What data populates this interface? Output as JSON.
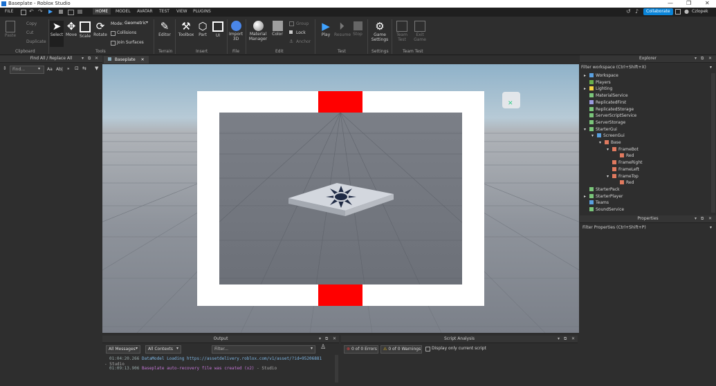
{
  "window": {
    "title": "Baseplate - Roblox Studio",
    "user": "Czlopek",
    "collaborate_label": "Collaborate"
  },
  "menu": {
    "file": "FILE",
    "tabs": [
      "HOME",
      "MODEL",
      "AVATAR",
      "TEST",
      "VIEW",
      "PLUGINS"
    ],
    "active_tab": "HOME"
  },
  "ribbon": {
    "clipboard": {
      "paste": "Paste",
      "copy": "Copy",
      "cut": "Cut",
      "duplicate": "Duplicate",
      "group": "Clipboard"
    },
    "tools": {
      "select": "Select",
      "move": "Move",
      "scale": "Scale",
      "rotate": "Rotate",
      "mode_label": "Mode:",
      "mode_value": "Geometric",
      "collisions": "Collisions",
      "join_surfaces": "Join Surfaces",
      "group": "Tools"
    },
    "terrain": {
      "editor": "Editor",
      "group": "Terrain"
    },
    "insert": {
      "toolbox": "Toolbox",
      "part": "Part",
      "ui": "UI",
      "group": "Insert"
    },
    "file": {
      "import3d_line1": "Import",
      "import3d_line2": "3D",
      "group": "File"
    },
    "edit": {
      "material_line1": "Material",
      "material_line2": "Manager",
      "color": "Color",
      "group_btn": "Group",
      "lock": "Lock",
      "anchor": "Anchor",
      "group": "Edit"
    },
    "test": {
      "play": "Play",
      "resume": "Resume",
      "stop": "Stop",
      "group": "Test"
    },
    "settings": {
      "game_line1": "Game",
      "game_line2": "Settings",
      "group": "Settings"
    },
    "team_test": {
      "team_line1": "Team",
      "team_line2": "Test",
      "exit_line1": "Exit",
      "exit_line2": "Game",
      "group": "Team Test"
    }
  },
  "find_panel": {
    "title": "Find All / Replace All",
    "search_placeholder": "Find...",
    "opt_case": "Aa",
    "opt_word": "Ab|"
  },
  "document_tab": "Baseplate",
  "explorer": {
    "title": "Explorer",
    "filter_placeholder": "Filter workspace (Ctrl+Shift+X)",
    "items": [
      {
        "label": "Workspace",
        "depth": 0,
        "arrow": "▸",
        "icon_color": "#5aa0e0"
      },
      {
        "label": "Players",
        "depth": 0,
        "arrow": "",
        "icon_color": "#6ab04c"
      },
      {
        "label": "Lighting",
        "depth": 0,
        "arrow": "▸",
        "icon_color": "#f5d442"
      },
      {
        "label": "MaterialService",
        "depth": 0,
        "arrow": "",
        "icon_color": "#7ac57a"
      },
      {
        "label": "ReplicatedFirst",
        "depth": 0,
        "arrow": "",
        "icon_color": "#9a9adf"
      },
      {
        "label": "ReplicatedStorage",
        "depth": 0,
        "arrow": "",
        "icon_color": "#7ac57a"
      },
      {
        "label": "ServerScriptService",
        "depth": 0,
        "arrow": "",
        "icon_color": "#7ac57a"
      },
      {
        "label": "ServerStorage",
        "depth": 0,
        "arrow": "",
        "icon_color": "#7ac57a"
      },
      {
        "label": "StarterGui",
        "depth": 0,
        "arrow": "▾",
        "icon_color": "#7ac57a"
      },
      {
        "label": "ScreenGui",
        "depth": 1,
        "arrow": "▾",
        "icon_color": "#5aa0e0"
      },
      {
        "label": "Base",
        "depth": 2,
        "arrow": "▾",
        "icon_color": "#e07a5f"
      },
      {
        "label": "FrameBot",
        "depth": 3,
        "arrow": "▾",
        "icon_color": "#e07a5f"
      },
      {
        "label": "Red",
        "depth": 4,
        "arrow": "",
        "icon_color": "#e07a5f"
      },
      {
        "label": "FrameRight",
        "depth": 3,
        "arrow": "",
        "icon_color": "#e07a5f"
      },
      {
        "label": "FrameLeft",
        "depth": 3,
        "arrow": "",
        "icon_color": "#e07a5f"
      },
      {
        "label": "FrameTop",
        "depth": 3,
        "arrow": "▾",
        "icon_color": "#e07a5f"
      },
      {
        "label": "Red",
        "depth": 4,
        "arrow": "",
        "icon_color": "#e07a5f"
      },
      {
        "label": "StarterPack",
        "depth": 0,
        "arrow": "",
        "icon_color": "#7ac57a"
      },
      {
        "label": "StarterPlayer",
        "depth": 0,
        "arrow": "▸",
        "icon_color": "#7ac57a"
      },
      {
        "label": "Teams",
        "depth": 0,
        "arrow": "",
        "icon_color": "#5aa0e0"
      },
      {
        "label": "SoundService",
        "depth": 0,
        "arrow": "",
        "icon_color": "#7ac57a"
      }
    ]
  },
  "properties": {
    "title": "Properties",
    "filter_placeholder": "Filter Properties (Ctrl+Shift+P)"
  },
  "output": {
    "title": "Output",
    "messages_filter": "All Messages",
    "contexts_filter": "All Contexts",
    "filter_placeholder": "Filter...",
    "log": [
      {
        "time": "01:04:20.266",
        "text": "DataModel Loading https://assetdelivery.roblox.com/v1/asset/?id=95206881",
        "suffix": "- Studio",
        "color": "#7fb8e6"
      },
      {
        "time": "01:09:13.906",
        "text": "Baseplate auto-recovery file was created (x2)",
        "suffix": "- Studio",
        "color": "#c777d9"
      }
    ]
  },
  "script_analysis": {
    "title": "Script Analysis",
    "errors": "0 of 0 Errors",
    "warnings": "0 of 0 Warnings",
    "current_only": "Display only current script"
  },
  "colors": {
    "accent": "#0a84d8",
    "frame_white": "#ffffff",
    "frame_red": "#ff0000",
    "inner": "#6f737b"
  }
}
